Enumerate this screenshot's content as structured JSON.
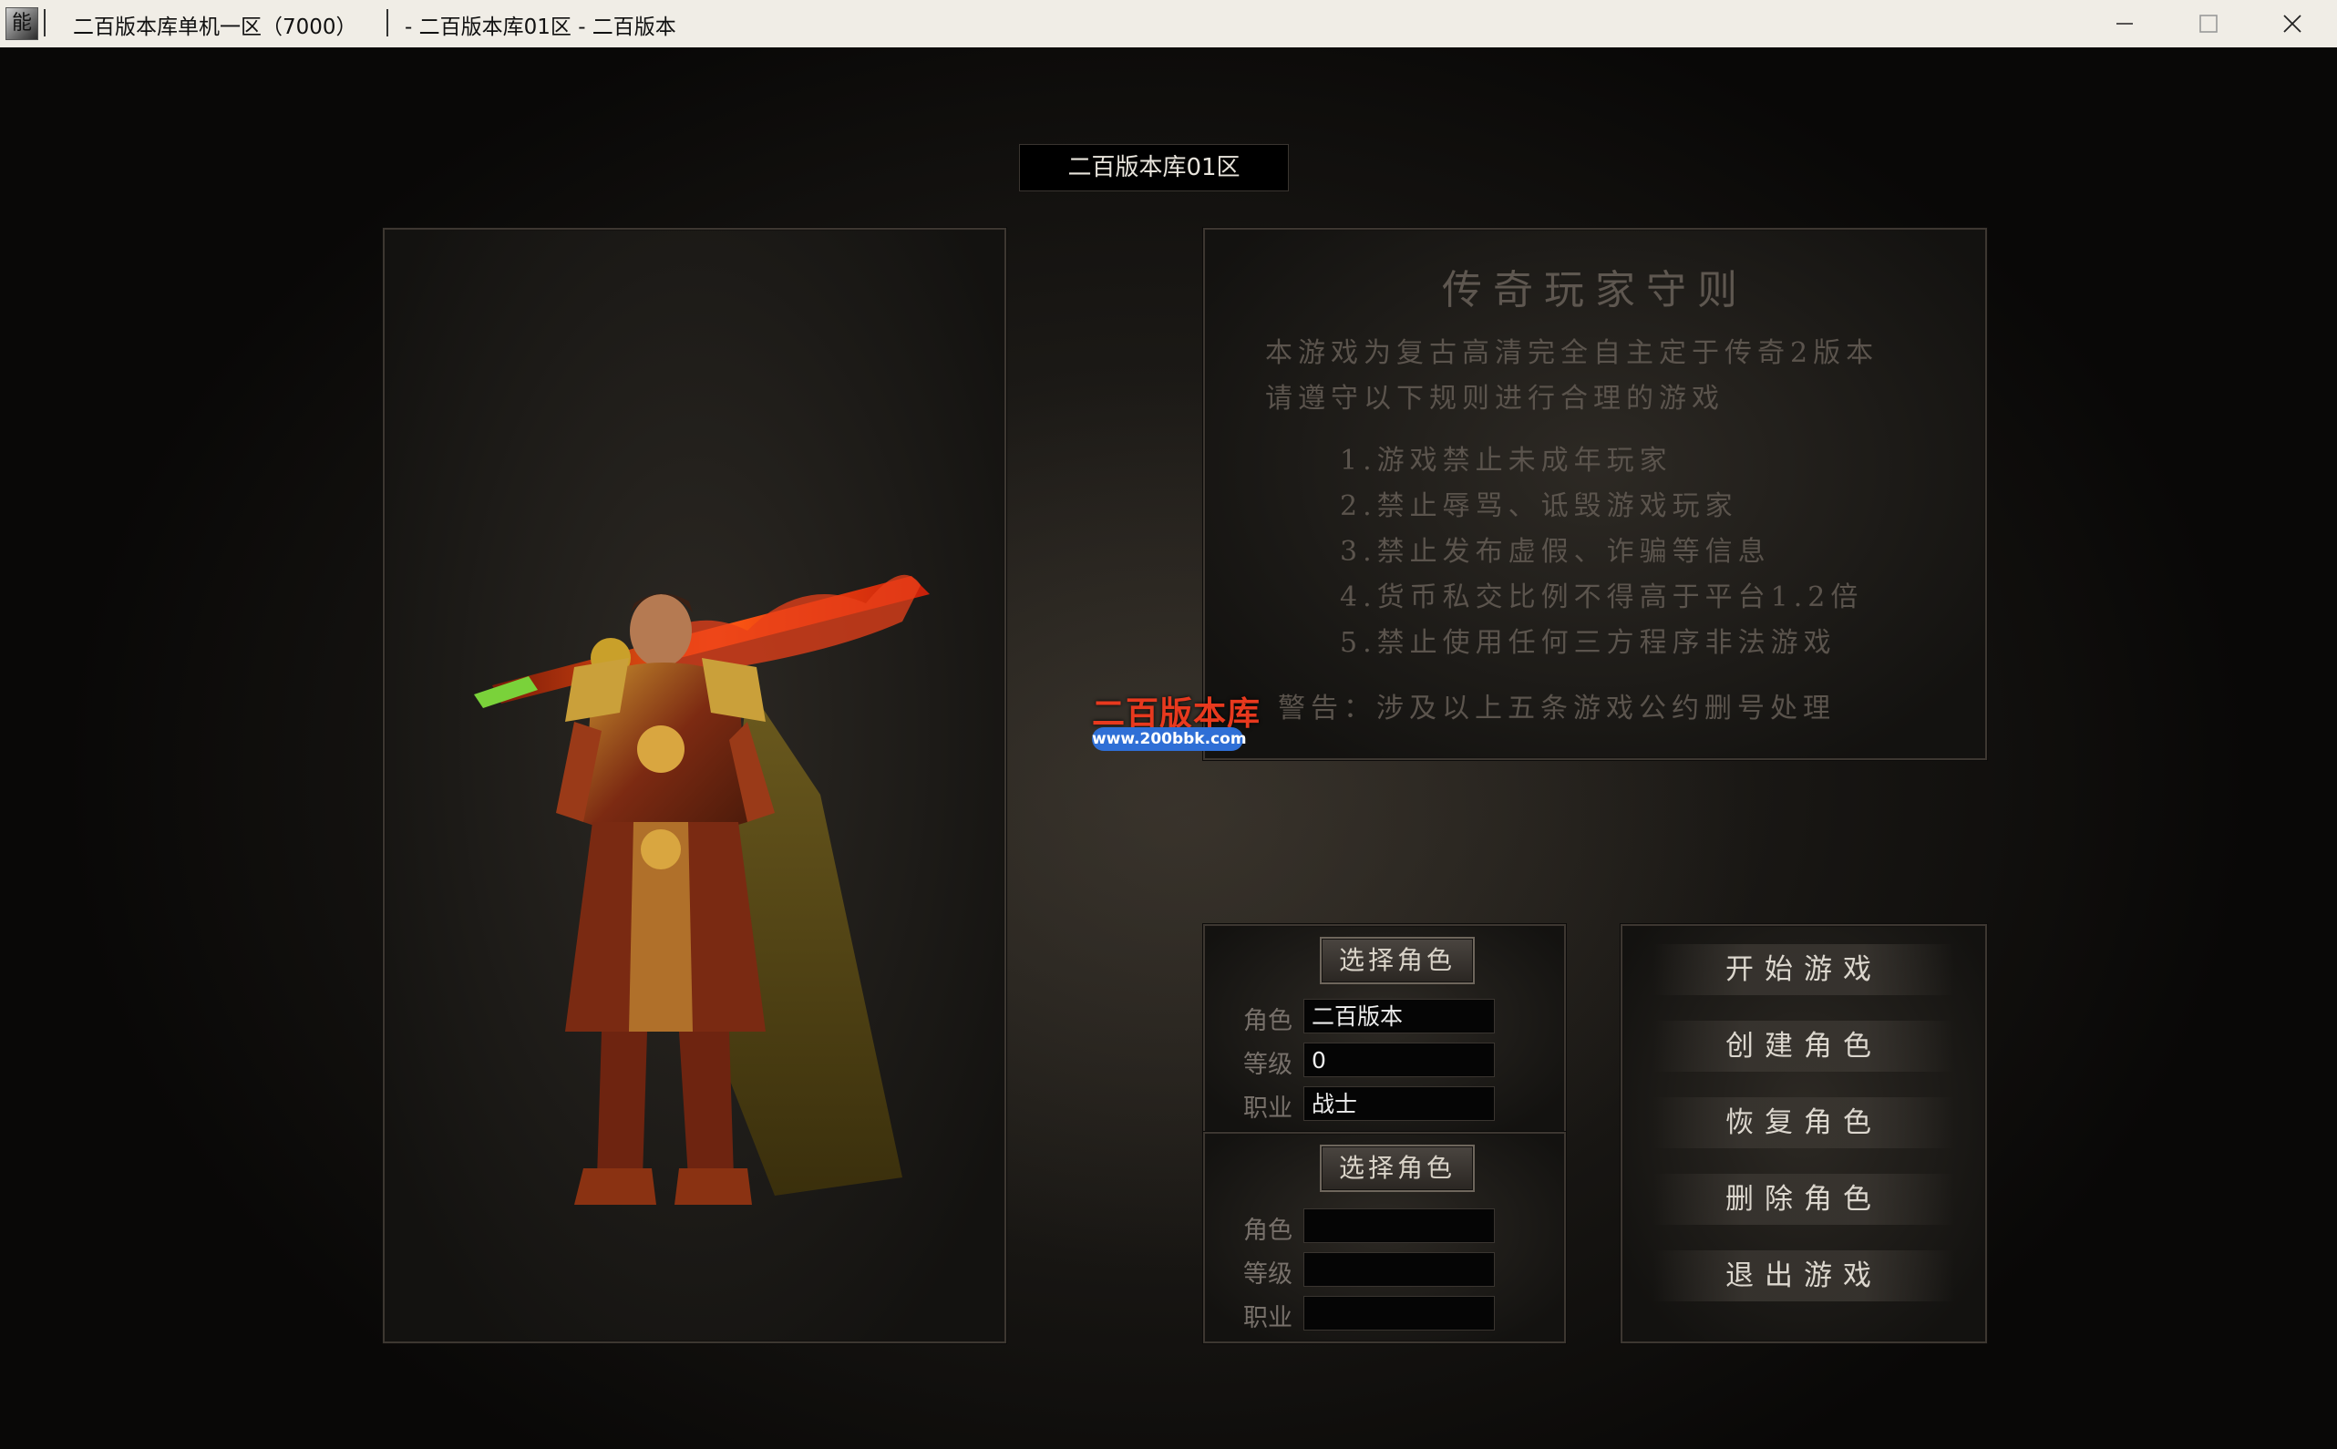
{
  "titlebar": {
    "app_icon_glyph": "能",
    "server_title": "二百版本库单机一区（7000）",
    "window_title": "- 二百版本库01区 - 二百版本"
  },
  "server_name": "二百版本库01区",
  "rules": {
    "title": "传奇玩家守则",
    "intro": [
      "本游戏为复古高清完全自主定于传奇2版本",
      "请遵守以下规则进行合理的游戏"
    ],
    "items": [
      "1.游戏禁止未成年玩家",
      "2.禁止辱骂、诋毁游戏玩家",
      "3.禁止发布虚假、诈骗等信息",
      "4.货币私交比例不得高于平台1.2倍",
      "5.禁止使用任何三方程序非法游戏"
    ],
    "warning": "警告：涉及以上五条游戏公约删号处理"
  },
  "watermark": {
    "name": "二百版本库",
    "url": "www.200bbk.com"
  },
  "slots": [
    {
      "select_label": "选择角色",
      "role_label": "角色",
      "level_label": "等级",
      "class_label": "职业",
      "role": "二百版本",
      "level": "0",
      "class": "战士"
    },
    {
      "select_label": "选择角色",
      "role_label": "角色",
      "level_label": "等级",
      "class_label": "职业",
      "role": "",
      "level": "",
      "class": ""
    }
  ],
  "menu": {
    "start": "开始游戏",
    "create": "创建角色",
    "restore": "恢复角色",
    "delete": "删除角色",
    "exit": "退出游戏"
  },
  "colors": {
    "rules_text": "#5b544d",
    "watermark_red": "#e8391e",
    "watermark_blue": "#2f6fd6"
  }
}
